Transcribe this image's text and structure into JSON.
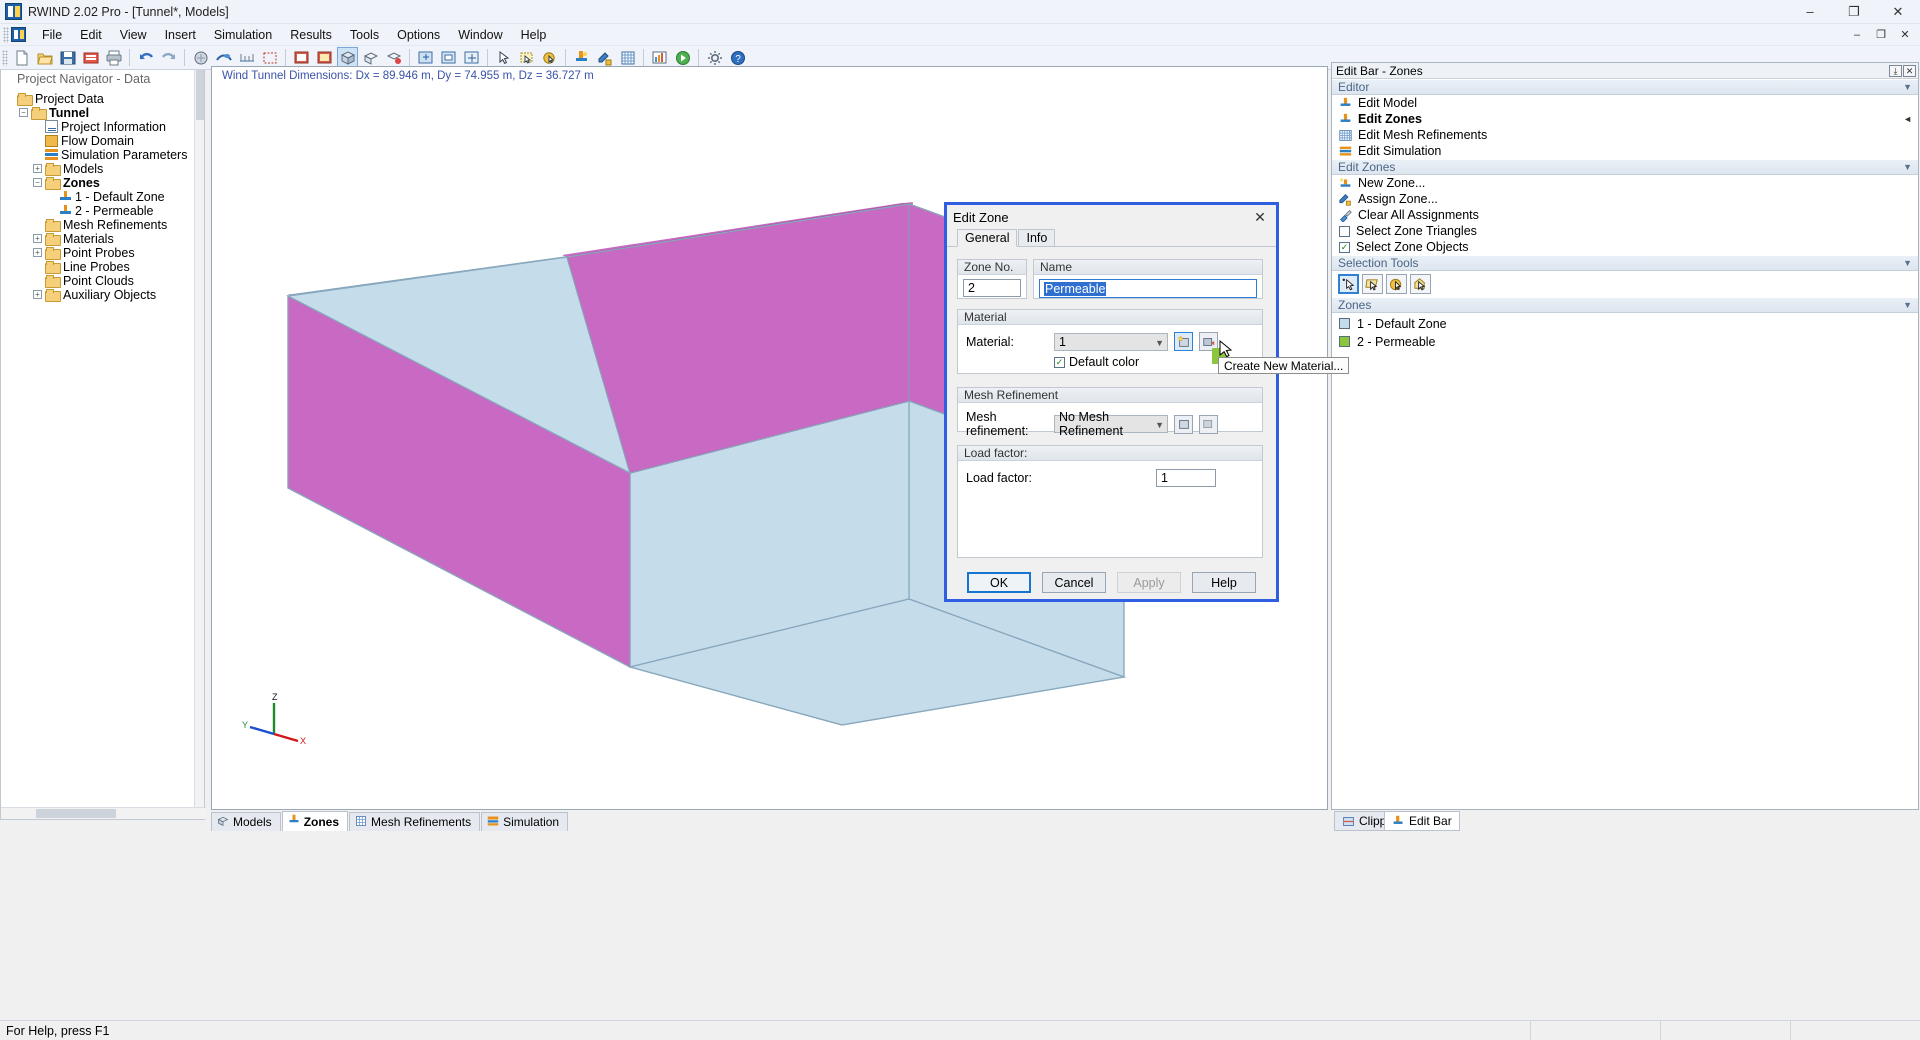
{
  "window": {
    "title": "RWIND 2.02 Pro - [Tunnel*, Models]",
    "minimize": "–",
    "maximize": "❐",
    "close": "✕",
    "inner_minimize": "–",
    "inner_maximize": "❐",
    "inner_close": "✕"
  },
  "menu": {
    "items": [
      "File",
      "Edit",
      "View",
      "Insert",
      "Simulation",
      "Results",
      "Tools",
      "Options",
      "Window",
      "Help"
    ]
  },
  "navigator": {
    "title": "Project Navigator - Data",
    "tree": [
      {
        "label": "Project Data",
        "icon": "folder-icon",
        "expander": "",
        "depth": 0,
        "bold": false
      },
      {
        "label": "Tunnel",
        "icon": "folder-icon",
        "expander": "−",
        "depth": 1,
        "bold": true
      },
      {
        "label": "Project Information",
        "icon": "document-icon",
        "expander": "",
        "depth": 2,
        "bold": false
      },
      {
        "label": "Flow Domain",
        "icon": "cube-icon",
        "expander": "",
        "depth": 2,
        "bold": false
      },
      {
        "label": "Simulation Parameters",
        "icon": "parameters-icon",
        "expander": "",
        "depth": 2,
        "bold": false
      },
      {
        "label": "Models",
        "icon": "folder-icon",
        "expander": "+",
        "depth": 2,
        "bold": false
      },
      {
        "label": "Zones",
        "icon": "folder-icon",
        "expander": "−",
        "depth": 2,
        "bold": true
      },
      {
        "label": "1 - Default Zone",
        "icon": "zone-icon",
        "expander": "",
        "depth": 3,
        "bold": false
      },
      {
        "label": "2 - Permeable",
        "icon": "zone-icon",
        "expander": "",
        "depth": 3,
        "bold": false
      },
      {
        "label": "Mesh Refinements",
        "icon": "folder-icon",
        "expander": "",
        "depth": 2,
        "bold": false
      },
      {
        "label": "Materials",
        "icon": "folder-icon",
        "expander": "+",
        "depth": 2,
        "bold": false
      },
      {
        "label": "Point Probes",
        "icon": "folder-icon",
        "expander": "+",
        "depth": 2,
        "bold": false
      },
      {
        "label": "Line Probes",
        "icon": "folder-icon",
        "expander": "",
        "depth": 2,
        "bold": false
      },
      {
        "label": "Point Clouds",
        "icon": "folder-icon",
        "expander": "",
        "depth": 2,
        "bold": false
      },
      {
        "label": "Auxiliary Objects",
        "icon": "folder-icon",
        "expander": "+",
        "depth": 2,
        "bold": false
      }
    ]
  },
  "viewport": {
    "dimensions_label": "Wind Tunnel Dimensions: Dx = 89.946 m, Dy = 74.955 m, Dz = 36.727 m",
    "axis": {
      "x": "X",
      "y": "Y",
      "z": "Z"
    },
    "colors": {
      "face_magenta": "#c86ac4",
      "face_lightblue": "#c5dceb",
      "edge": "#7a9bb0"
    }
  },
  "bottom_tabs": [
    {
      "label": "Models",
      "active": false,
      "icon": "models-icon"
    },
    {
      "label": "Zones",
      "active": true,
      "icon": "zones-icon"
    },
    {
      "label": "Mesh Refinements",
      "active": false,
      "icon": "mesh-icon"
    },
    {
      "label": "Simulation",
      "active": false,
      "icon": "simulation-icon"
    }
  ],
  "editbar": {
    "title": "Edit Bar - Zones",
    "pin_glyph": "⤓",
    "close_glyph": "✕",
    "sections": [
      {
        "title": "Editor",
        "items": [
          {
            "label": "Edit Model",
            "icon": "zone-icon",
            "bold": false,
            "arrow": false
          },
          {
            "label": "Edit Zones",
            "icon": "zone-icon",
            "bold": true,
            "arrow": true
          },
          {
            "label": "Edit Mesh Refinements",
            "icon": "grid-icon",
            "bold": false,
            "arrow": false
          },
          {
            "label": "Edit Simulation",
            "icon": "parameters-icon",
            "bold": false,
            "arrow": false
          }
        ]
      },
      {
        "title": "Edit Zones",
        "items": [
          {
            "label": "New Zone...",
            "icon": "new-zone-icon",
            "bold": false,
            "arrow": false
          },
          {
            "label": "Assign Zone...",
            "icon": "assign-zone-icon",
            "bold": false,
            "arrow": false
          },
          {
            "label": "Clear All Assignments",
            "icon": "brush-icon",
            "bold": false,
            "arrow": false
          },
          {
            "label": "Select Zone Triangles",
            "icon": "checkbox-unchecked-icon",
            "bold": false,
            "arrow": false,
            "checkbox": true,
            "checked": false
          },
          {
            "label": "Select Zone Objects",
            "icon": "checkbox-checked-icon",
            "bold": false,
            "arrow": false,
            "checkbox": true,
            "checked": true
          }
        ]
      }
    ],
    "selection_tools": {
      "title": "Selection Tools",
      "tools": [
        {
          "name": "single-select-tool",
          "active": true
        },
        {
          "name": "rectangle-select-tool",
          "active": false
        },
        {
          "name": "circle-select-tool",
          "active": false
        },
        {
          "name": "polygon-select-tool",
          "active": false
        }
      ]
    },
    "zones": {
      "title": "Zones",
      "list": [
        {
          "label": "1 - Default Zone",
          "color": "#c3ddec"
        },
        {
          "label": "2 - Permeable",
          "color": "#8cc63e"
        }
      ]
    }
  },
  "docks": {
    "clipper": "Clipper",
    "edit_bar": "Edit Bar"
  },
  "dialog": {
    "title": "Edit Zone",
    "close_glyph": "✕",
    "tabs": [
      {
        "label": "General",
        "active": true
      },
      {
        "label": "Info",
        "active": false
      }
    ],
    "zone_no": {
      "label": "Zone No.",
      "value": "2"
    },
    "name": {
      "label": "Name",
      "value": "Permeable"
    },
    "material": {
      "group_label": "Material",
      "field_label": "Material:",
      "value": "1",
      "new_button": "create-new-material-button",
      "edit_button": "edit-material-button",
      "default_color": {
        "label": "Default color",
        "checked": true
      }
    },
    "mesh_refinement": {
      "group_label": "Mesh Refinement",
      "field_label": "Mesh refinement:",
      "value": "No Mesh Refinement"
    },
    "load_factor": {
      "group_label": "Load factor:",
      "field_label": "Load factor:",
      "value": "1"
    },
    "buttons": [
      {
        "label": "OK",
        "state": "default"
      },
      {
        "label": "Cancel",
        "state": "normal"
      },
      {
        "label": "Apply",
        "state": "disabled"
      },
      {
        "label": "Help",
        "state": "normal"
      }
    ],
    "tooltip": "Create New Material..."
  },
  "statusbar": {
    "message": "For Help, press F1"
  }
}
